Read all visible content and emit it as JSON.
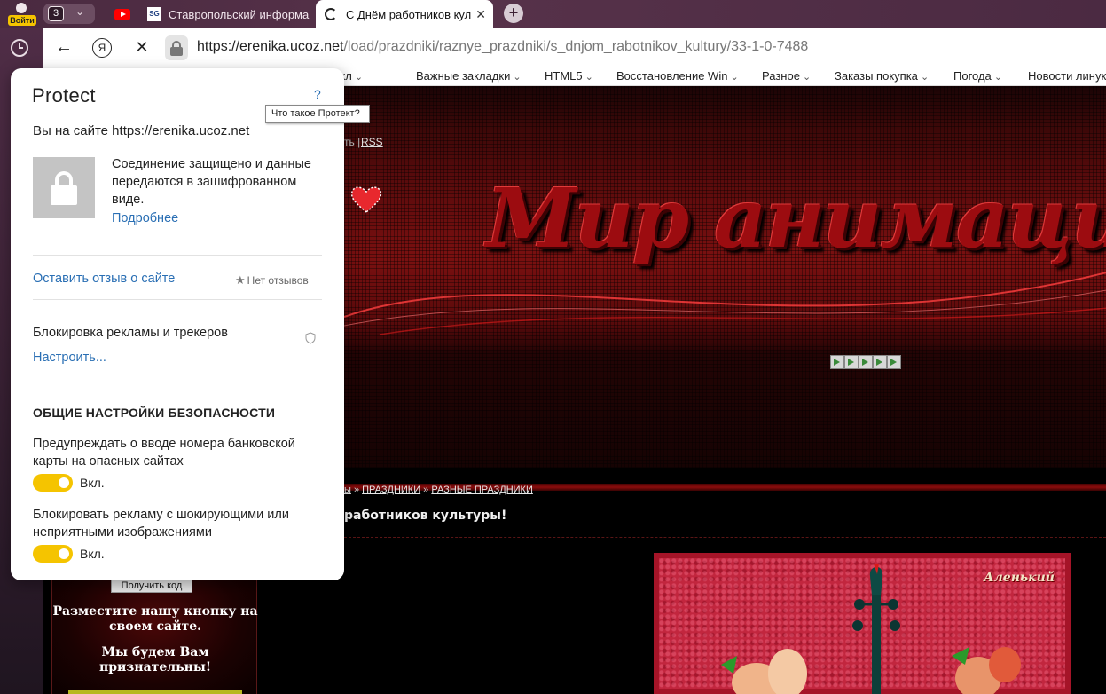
{
  "tabstrip": {
    "login_label": "Войти",
    "tab_count": "3",
    "tabs": [
      {
        "title": "",
        "icon": "youtube-icon"
      },
      {
        "title": "Ставропольский информа",
        "icon": "sg-favicon"
      },
      {
        "title": "С Днём работников кул",
        "icon": "loading-spinner-icon",
        "active": true
      }
    ]
  },
  "navbar": {
    "url_host": "https://erenika.ucoz.net",
    "url_path": "/load/prazdniki/raznye_prazdniki/s_dnjom_rabotnikov_kultury/33-1-0-7488",
    "ya_label": "Я"
  },
  "bookmarks": [
    "ые закл",
    "Важные закладки",
    "HTML5",
    "Восстановление Win",
    "Разное",
    "Заказы покупка",
    "Погода",
    "Новости линук"
  ],
  "page": {
    "rss_sep": "ть |",
    "rss": "RSS",
    "logo_text": "Мир анимации",
    "breadcrumb_start": "ы",
    "breadcrumb_sep1": " » ",
    "breadcrumb_1": "ПРАЗДНИКИ",
    "breadcrumb_sep2": " » ",
    "breadcrumb_2": "РАЗНЫЕ ПРАЗДНИКИ",
    "article_title": "работников культуры!",
    "get_code": "Получить код",
    "promo_1": "Разместите нашу кнопку на своем сайте.",
    "promo_2": "Мы будем Вам признательны!",
    "postcard_signature": "Аленький"
  },
  "protect": {
    "logo": "Protect",
    "help": "?",
    "tooltip": "Что такое Протект?",
    "site_line": "Вы на сайте https://erenika.ucoz.net",
    "secure_text": "Соединение защищено и данные передаются в зашифрованном виде.",
    "more_link": "Подробнее",
    "feedback_link": "Оставить отзыв о сайте",
    "no_reviews": "Нет отзывов",
    "adblock_label": "Блокировка рекламы и трекеров",
    "configure_link": "Настроить...",
    "general_heading": "ОБЩИЕ НАСТРОЙКИ БЕЗОПАСНОСТИ",
    "settings": [
      {
        "text": "Предупреждать о вводе номера банковской карты на опасных сайтах",
        "state": "Вкл.",
        "enabled": true
      },
      {
        "text": "Блокировать рекламу с шокирующими или неприятными изображениями",
        "state": "Вкл.",
        "enabled": true
      }
    ]
  },
  "colors": {
    "accent_yellow": "#f5c400",
    "link_blue": "#2a6fb4",
    "page_red": "#9c0c10"
  }
}
